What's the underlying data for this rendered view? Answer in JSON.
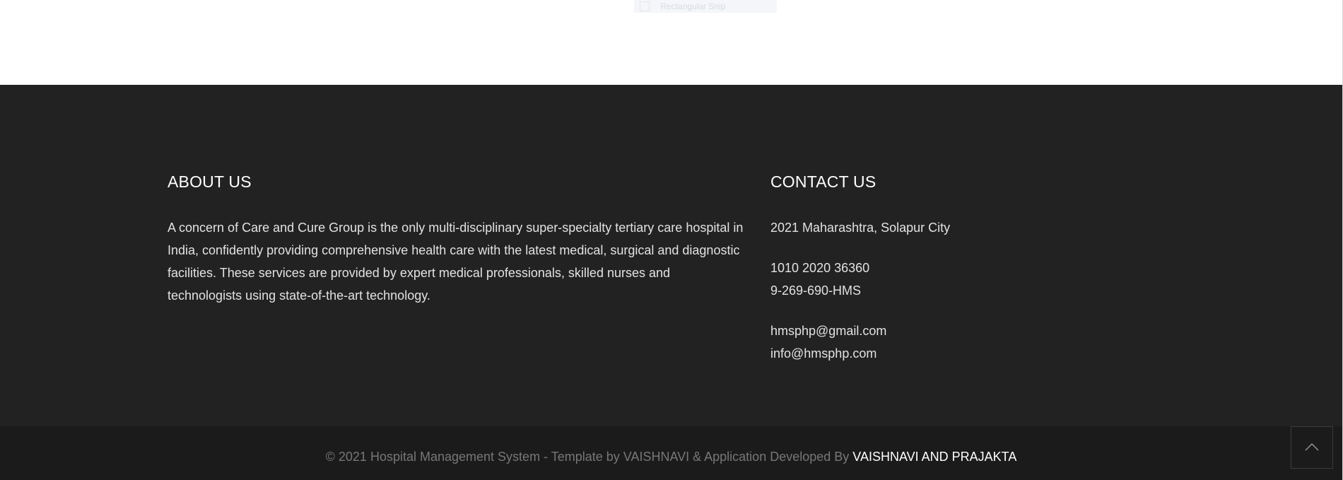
{
  "snip_overlay": {
    "label": "Rectangular Snip",
    "icon": "scissors-icon"
  },
  "about": {
    "title": "ABOUT US",
    "text": "A concern of Care and Cure Group is the only multi-disciplinary super-specialty tertiary care hospital in India, confidently providing comprehensive health care with the latest medical, surgical and diagnostic facilities. These services are provided by expert medical professionals, skilled nurses and technologists using state-of-the-art technology."
  },
  "contact": {
    "title": "CONTACT US",
    "address": "2021 Maharashtra, Solapur City",
    "phones": [
      "1010 2020 36360",
      "9-269-690-HMS"
    ],
    "emails": [
      "hmsphp@gmail.com",
      "info@hmsphp.com"
    ]
  },
  "copyright": {
    "text": "© 2021 Hospital Management System - Template by VAISHNAVI & Application Developed By ",
    "authors": "VAISHNAVI AND PRAJAKTA"
  },
  "back_to_top": {
    "icon": "chevron-up-icon"
  },
  "colors": {
    "footer_bg": "#222222",
    "copyright_bg": "#1b1b1b",
    "heading": "#ffffff",
    "body_text": "#e2e2e2",
    "muted_text": "#777777"
  }
}
